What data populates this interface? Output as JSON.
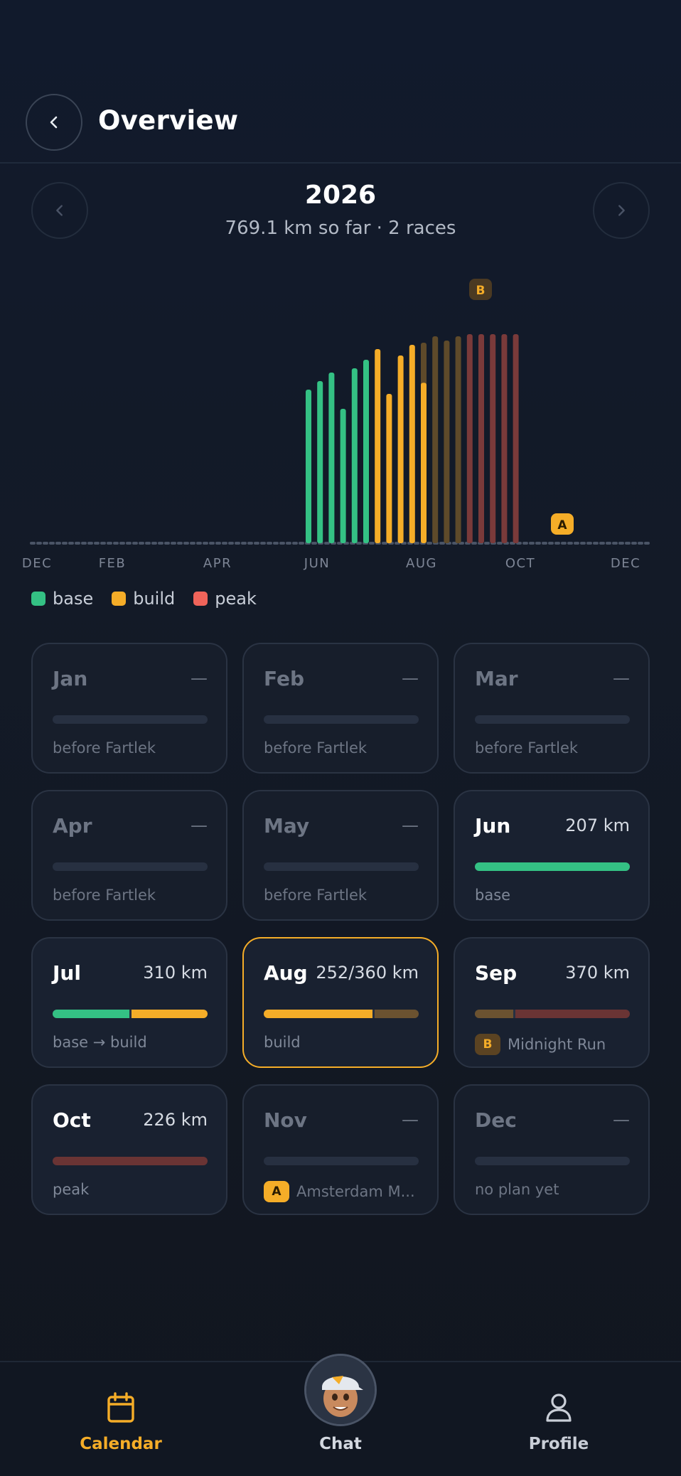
{
  "header": {
    "title": "Overview"
  },
  "year_nav": {
    "year": "2026",
    "summary": "769.1 km so far · 2 races"
  },
  "colors": {
    "base": "#34c184",
    "build": "#f5ad28",
    "peak": "#7a3a3a",
    "peak_legend": "#f0645a",
    "accent": "#f5ad28"
  },
  "chart_data": {
    "type": "bar",
    "x_tick_labels": [
      "DEC",
      "FEB",
      "APR",
      "JUN",
      "AUG",
      "OCT",
      "DEC"
    ],
    "phases": [
      "base",
      "build",
      "peak"
    ],
    "legend": [
      "base",
      "build",
      "peak"
    ],
    "weekly_bars": [
      {
        "phase": "base",
        "value": 0.72
      },
      {
        "phase": "base",
        "value": 0.76
      },
      {
        "phase": "base",
        "value": 0.8
      },
      {
        "phase": "base",
        "value": 0.63
      },
      {
        "phase": "base",
        "value": 0.82
      },
      {
        "phase": "base",
        "value": 0.86
      },
      {
        "phase": "build",
        "value": 0.91
      },
      {
        "phase": "build",
        "value": 0.7
      },
      {
        "phase": "build",
        "value": 0.88
      },
      {
        "phase": "build",
        "value": 0.93,
        "fill": 1.0
      },
      {
        "phase": "build",
        "value": 0.94,
        "fill": 0.8
      },
      {
        "phase": "build",
        "value": 0.97,
        "fill": 0
      },
      {
        "phase": "build",
        "value": 0.95,
        "fill": 0
      },
      {
        "phase": "build",
        "value": 0.97,
        "fill": 0
      },
      {
        "phase": "peak",
        "value": 0.98
      },
      {
        "phase": "peak",
        "value": 0.98
      },
      {
        "phase": "peak",
        "value": 0.98
      },
      {
        "phase": "peak",
        "value": 0.98
      },
      {
        "phase": "peak",
        "value": 0.98
      }
    ],
    "race_markers": [
      "B",
      "A"
    ]
  },
  "legend": {
    "base": "base",
    "build": "build",
    "peak": "peak"
  },
  "months": [
    {
      "name": "Jan",
      "km": "—",
      "sub": "before Fartlek",
      "state": "dim",
      "segments": []
    },
    {
      "name": "Feb",
      "km": "—",
      "sub": "before Fartlek",
      "state": "dim",
      "segments": []
    },
    {
      "name": "Mar",
      "km": "—",
      "sub": "before Fartlek",
      "state": "dim",
      "segments": []
    },
    {
      "name": "Apr",
      "km": "—",
      "sub": "before Fartlek",
      "state": "dim",
      "segments": []
    },
    {
      "name": "May",
      "km": "—",
      "sub": "before Fartlek",
      "state": "dim",
      "segments": []
    },
    {
      "name": "Jun",
      "km": "207 km",
      "sub": "base",
      "state": "done",
      "segments": [
        {
          "color": "#34c184",
          "fraction": 1.0
        }
      ]
    },
    {
      "name": "Jul",
      "km": "310 km",
      "sub": "base → build",
      "state": "done",
      "segments": [
        {
          "color": "#34c184",
          "fraction": 0.5
        },
        {
          "color": "#f5ad28",
          "fraction": 0.5
        }
      ]
    },
    {
      "name": "Aug",
      "km": "252/360 km",
      "sub": "build",
      "state": "current",
      "segments": [
        {
          "color": "#f5ad28",
          "fraction": 0.71
        },
        {
          "color": "#6b5230",
          "fraction": 0.29
        }
      ]
    },
    {
      "name": "Sep",
      "km": "370 km",
      "sub": "Midnight Run",
      "badge": "B",
      "state": "done",
      "segments": [
        {
          "color": "#6b5230",
          "fraction": 0.25
        },
        {
          "color": "#6a3434",
          "fraction": 0.75
        }
      ]
    },
    {
      "name": "Oct",
      "km": "226 km",
      "sub": "peak",
      "state": "done",
      "segments": [
        {
          "color": "#6a3434",
          "fraction": 1.0
        }
      ]
    },
    {
      "name": "Nov",
      "km": "—",
      "sub": "Amsterdam M...",
      "badge": "A",
      "state": "dim",
      "segments": []
    },
    {
      "name": "Dec",
      "km": "—",
      "sub": "no plan yet",
      "state": "dim",
      "segments": []
    }
  ],
  "bottom_nav": {
    "calendar": "Calendar",
    "chat": "Chat",
    "profile": "Profile"
  }
}
